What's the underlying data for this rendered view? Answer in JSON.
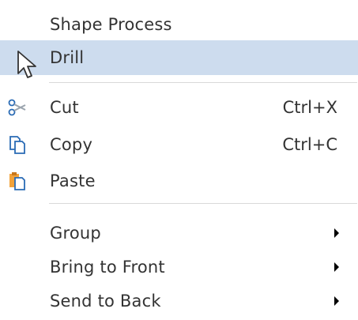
{
  "context_menu": {
    "items": [
      {
        "label": "Shape Process"
      },
      {
        "label": "Drill"
      },
      {
        "label": "Cut",
        "shortcut": "Ctrl+X",
        "icon": "scissors-icon"
      },
      {
        "label": "Copy",
        "shortcut": "Ctrl+C",
        "icon": "copy-icon"
      },
      {
        "label": "Paste",
        "icon": "paste-icon"
      },
      {
        "label": "Group",
        "submenu": true
      },
      {
        "label": "Bring to Front",
        "submenu": true
      },
      {
        "label": "Send to Back",
        "submenu": true
      }
    ],
    "highlighted_item": "Drill",
    "colors": {
      "highlight": "#cddcee",
      "divider": "#d9d9d9",
      "icon_blue": "#2a6bb5",
      "icon_orange": "#f2a23a"
    }
  }
}
